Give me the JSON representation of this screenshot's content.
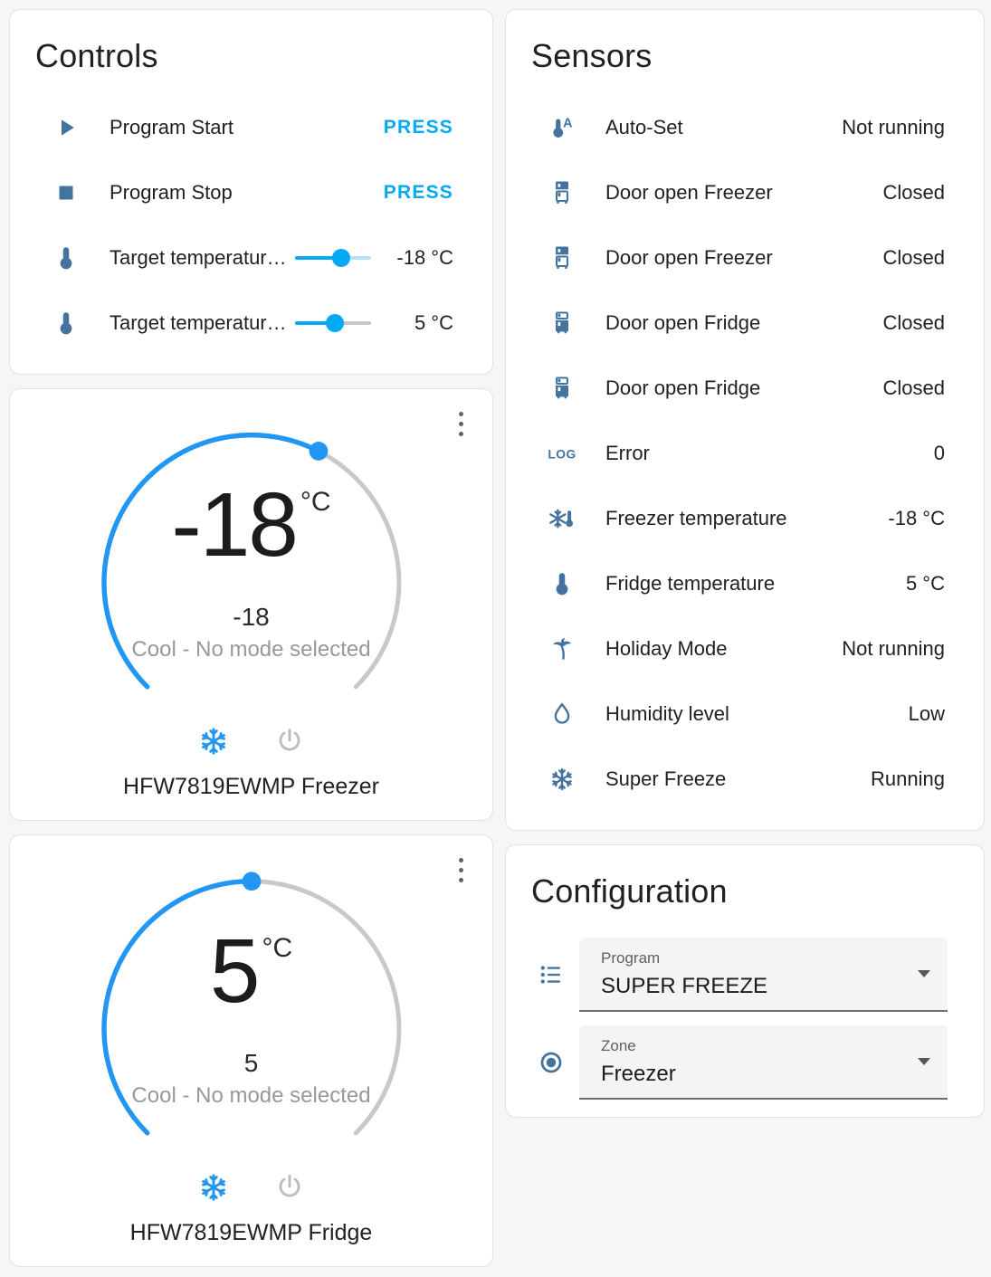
{
  "colors": {
    "accent": "#03a9f4",
    "icon_blue": "#44739e",
    "dial_blue": "#2196f3",
    "dial_gray": "#c8c8c8",
    "slider_rest_lightblue": "#b5e0f8",
    "slider_rest_gray": "#c6c6c6"
  },
  "controls": {
    "title": "Controls",
    "rows": [
      {
        "icon": "play-icon",
        "label": "Program Start",
        "action": "PRESS"
      },
      {
        "icon": "stop-icon",
        "label": "Program Stop",
        "action": "PRESS"
      },
      {
        "icon": "thermometer-icon",
        "label": "Target temperatur…",
        "value": "-18 °C",
        "slider": {
          "fraction": 0.61,
          "rest_color": "#b5e0f8"
        }
      },
      {
        "icon": "thermometer-icon",
        "label": "Target temperatur…",
        "value": "5 °C",
        "slider": {
          "fraction": 0.52,
          "rest_color": "#c6c6c6"
        }
      }
    ]
  },
  "sensors": {
    "title": "Sensors",
    "rows": [
      {
        "icon": "thermometer-auto-icon",
        "label": "Auto-Set",
        "value": "Not running"
      },
      {
        "icon": "fridge-top-icon",
        "label": "Door open Freezer",
        "value": "Closed"
      },
      {
        "icon": "fridge-top-icon",
        "label": "Door open Freezer",
        "value": "Closed"
      },
      {
        "icon": "fridge-bottom-icon",
        "label": "Door open Fridge",
        "value": "Closed"
      },
      {
        "icon": "fridge-bottom-icon",
        "label": "Door open Fridge",
        "value": "Closed"
      },
      {
        "icon": "log-icon",
        "label": "Error",
        "value": "0"
      },
      {
        "icon": "snowflake-thermometer-icon",
        "label": "Freezer temperature",
        "value": "-18 °C"
      },
      {
        "icon": "thermometer-icon",
        "label": "Fridge temperature",
        "value": "5 °C"
      },
      {
        "icon": "palm-tree-icon",
        "label": "Holiday Mode",
        "value": "Not running"
      },
      {
        "icon": "water-drop-icon",
        "label": "Humidity level",
        "value": "Low"
      },
      {
        "icon": "snowflake-icon",
        "label": "Super Freeze",
        "value": "Running"
      }
    ]
  },
  "thermostats": [
    {
      "value": "-18",
      "unit": "°C",
      "current": "-18",
      "mode_text": "Cool - No mode selected",
      "name": "HFW7819EWMP Freezer",
      "dial_fraction": 0.6,
      "modes": [
        {
          "icon": "snowflake-icon",
          "state": "on"
        },
        {
          "icon": "power-icon",
          "state": "off"
        }
      ]
    },
    {
      "value": "5",
      "unit": "°C",
      "current": "5",
      "mode_text": "Cool - No mode selected",
      "name": "HFW7819EWMP Fridge",
      "dial_fraction": 0.5,
      "modes": [
        {
          "icon": "snowflake-icon",
          "state": "on"
        },
        {
          "icon": "power-icon",
          "state": "off"
        }
      ]
    }
  ],
  "configuration": {
    "title": "Configuration",
    "fields": [
      {
        "icon": "list-icon",
        "label": "Program",
        "value": "SUPER FREEZE"
      },
      {
        "icon": "radiobox-icon",
        "label": "Zone",
        "value": "Freezer"
      }
    ]
  }
}
